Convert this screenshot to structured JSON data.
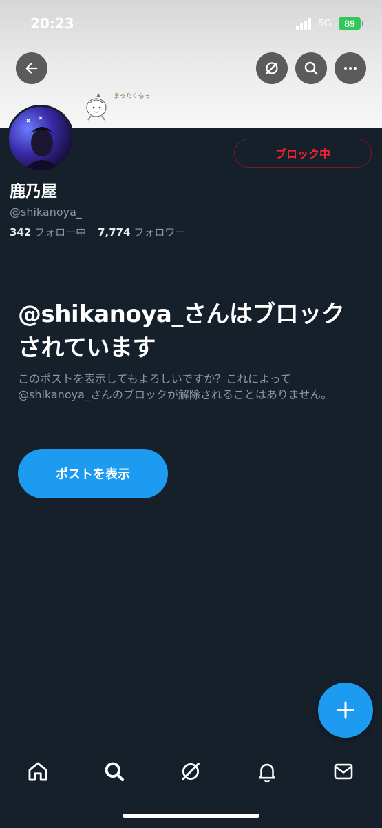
{
  "status_bar": {
    "time": "20:23",
    "network": "5G",
    "battery": "89"
  },
  "header": {
    "back_icon": "arrow-left-icon",
    "grok_icon": "grok-icon",
    "search_icon": "search-icon",
    "more_icon": "more-horizontal-icon",
    "banner_sticker_text": "まったくもぅ"
  },
  "profile": {
    "display_name": "鹿乃屋",
    "handle": "@shikanoya_",
    "following_count": "342",
    "following_label": "フォロー中",
    "followers_count": "7,774",
    "followers_label": "フォロワー",
    "block_button_label": "ブロック中"
  },
  "blocked_notice": {
    "title": "@shikanoya_さんはブロックされています",
    "description": "このポストを表示してもよろしいですか？これによって@shikanoya_さんのブロックが解除されることはありません。",
    "view_posts_label": "ポストを表示"
  },
  "fab": {
    "icon": "plus-icon"
  },
  "bottom_nav": {
    "items": [
      {
        "icon": "home-icon"
      },
      {
        "icon": "search-icon"
      },
      {
        "icon": "grok-icon"
      },
      {
        "icon": "bell-icon"
      },
      {
        "icon": "mail-icon"
      }
    ]
  },
  "colors": {
    "background": "#15202b",
    "accent": "#1d9bf0",
    "blocked_red": "#f4212e",
    "muted_text": "#8b98a5",
    "battery_green": "#32c759"
  }
}
